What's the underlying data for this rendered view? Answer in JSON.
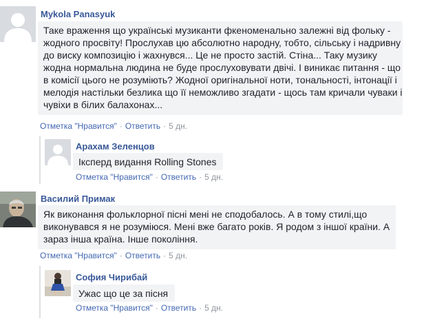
{
  "comments": [
    {
      "author": "Mykola Panasyuk",
      "avatar_icon": "default-avatar-icon",
      "lines": [
        "Таке враження що українські музиканти фкеноменально залежні від фольку -",
        "жодного просвіту! Прослухав цю абсолютно народну, тобто, сільську і надривну",
        "до виску композицію і жахнувся... Це не просто застій. Стіна... Таку музику",
        "жодна нормальна людина не буде прослуховувати двічі. І виникає питання - що",
        "в комісії цього не розуміють? Жодної оригінальної ноти, тональності, інтонації і",
        "мелодія настільки безлика що її неможливо згадати - щось там кричали чуваки і",
        "чувіхи в білих балахонах..."
      ],
      "like": "Отметка \"Нравится\"",
      "reply": "Ответить",
      "time": "5 дн."
    },
    {
      "author": "Арахам Зеленцов",
      "avatar_icon": "default-avatar-icon",
      "lines": [
        "Іксперд видання Rolling Stones"
      ],
      "like": "Отметка \"Нравится\"",
      "reply": "Ответить",
      "time": "5 дн."
    },
    {
      "author": "Василий Примак",
      "avatar_icon": "user-photo-avatar",
      "lines": [
        "Як виконання фольклорної пісні мені не сподобалось. А в тому стилі,що",
        "виконувався я не розуміюся. Мені вже багато років. Я родом з іншої країни. А",
        "зараз інша країна. Інше покоління."
      ],
      "like": "Отметка \"Нравится\"",
      "reply": "Ответить",
      "time": "5 дн."
    },
    {
      "author": "София Чирибай",
      "avatar_icon": "user-photo-avatar",
      "lines": [
        "Ужас що це за пісня"
      ],
      "like": "Отметка \"Нравится\"",
      "reply": "Ответить",
      "time": "5 дн."
    }
  ],
  "colors": {
    "link": "#385898",
    "action": "#4267b2",
    "meta": "#90949c",
    "bubble": "#f2f3f5"
  }
}
